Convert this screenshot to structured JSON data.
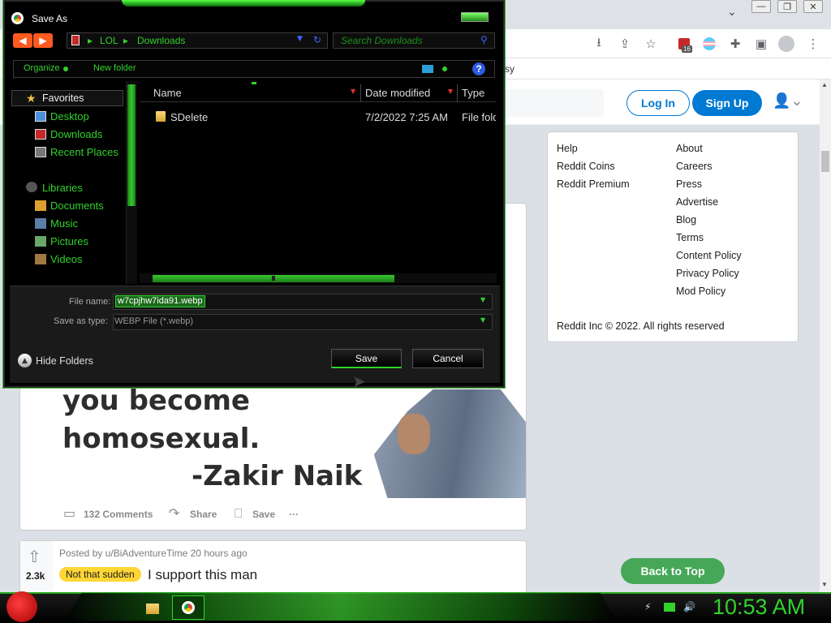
{
  "browser": {
    "window_controls": {
      "minimize": "—",
      "restore": "❐",
      "close": "✕"
    },
    "tab_chevron": "⌄",
    "toolbar_icons": [
      "download-icon",
      "share-icon",
      "star-icon",
      "extension-badge-icon",
      "profile-flag-icon",
      "puzzle-icon",
      "sidepanel-icon",
      "avatar-icon",
      "menu-icon"
    ],
    "extension_badge": "16",
    "bookmark_bar_text": "sy"
  },
  "reddit": {
    "login_label": "Log In",
    "signup_label": "Sign Up",
    "footer_col1": [
      "Help",
      "Reddit Coins",
      "Reddit Premium"
    ],
    "footer_col2": [
      "About",
      "Careers",
      "Press",
      "Advertise",
      "Blog",
      "Terms",
      "Content Policy",
      "Privacy Policy",
      "Mod Policy"
    ],
    "copyright": "Reddit Inc © 2022. All rights reserved",
    "post1": {
      "quote_lines": [
        "you become",
        "homosexual.",
        "-Zakir Naik"
      ],
      "comments": "132 Comments",
      "share": "Share",
      "save": "Save",
      "more": "···"
    },
    "post2": {
      "votes": "2.3k",
      "posted_by": "Posted by u/BiAdventureTime 20 hours ago",
      "flair": "Not that sudden",
      "title": "I support this man"
    },
    "back_to_top": "Back to Top"
  },
  "dialog": {
    "title": "Save As",
    "breadcrumb": [
      "LOL",
      "Downloads"
    ],
    "breadcrumb_sep": "▸",
    "search_placeholder": "Search Downloads",
    "organize_label": "Organize",
    "new_folder_label": "New folder",
    "help": "?",
    "nav": {
      "favorites_label": "Favorites",
      "favorites": [
        "Desktop",
        "Downloads",
        "Recent Places"
      ],
      "libraries_label": "Libraries",
      "libraries": [
        "Documents",
        "Music",
        "Pictures",
        "Videos"
      ]
    },
    "columns": {
      "name": "Name",
      "date": "Date modified",
      "type": "Type"
    },
    "files": [
      {
        "name": "SDelete",
        "date": "7/2/2022 7:25 AM",
        "type": "File folder"
      }
    ],
    "file_name_label": "File name:",
    "file_name_value": "w7cpjhw7ida91.webp",
    "save_type_label": "Save as type:",
    "save_type_value": "WEBP File (*.webp)",
    "hide_folders_label": "Hide Folders",
    "save_label": "Save",
    "cancel_label": "Cancel",
    "colors": {
      "accent": "#31d22b",
      "nav_button": "#ff5a1f",
      "link_blue": "#3b66ff"
    }
  },
  "taskbar": {
    "clock": "10:53 AM",
    "tray": [
      "network-icon",
      "battery-icon",
      "volume-icon"
    ]
  }
}
